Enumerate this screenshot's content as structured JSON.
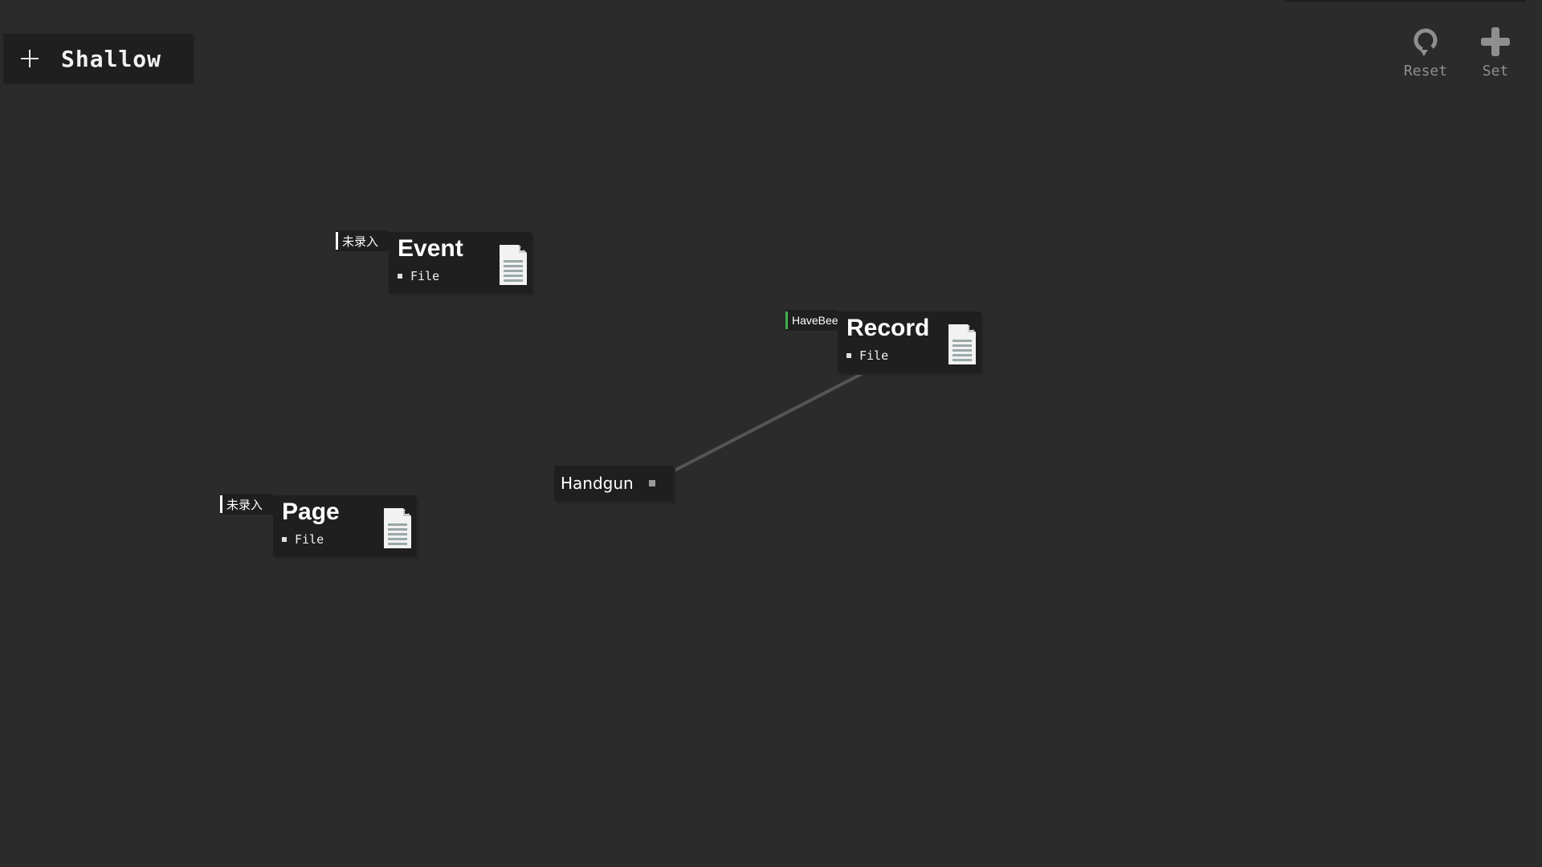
{
  "toolbar": {
    "mode_label": "Shallow",
    "reset_label": "Reset",
    "set_label": "Set"
  },
  "nodes": [
    {
      "title": "Event",
      "subtitle": "File",
      "tag": "未录入",
      "tag_color": "#ffffff"
    },
    {
      "title": "Record",
      "subtitle": "File",
      "tag": "HaveBee",
      "tag_color": "#3fae49"
    },
    {
      "title": "Page",
      "subtitle": "File",
      "tag": "未录入",
      "tag_color": "#ffffff"
    }
  ],
  "small_nodes": [
    {
      "label": "Handgun"
    }
  ],
  "icons": {
    "mode": "plus-icon",
    "reset": "reset-icon",
    "set": "plus-icon",
    "document": "document-icon"
  },
  "colors": {
    "background": "#2b2b2b",
    "node_background": "#1f1f1f",
    "edge": "#555555",
    "muted_text": "#8f8f8f"
  }
}
